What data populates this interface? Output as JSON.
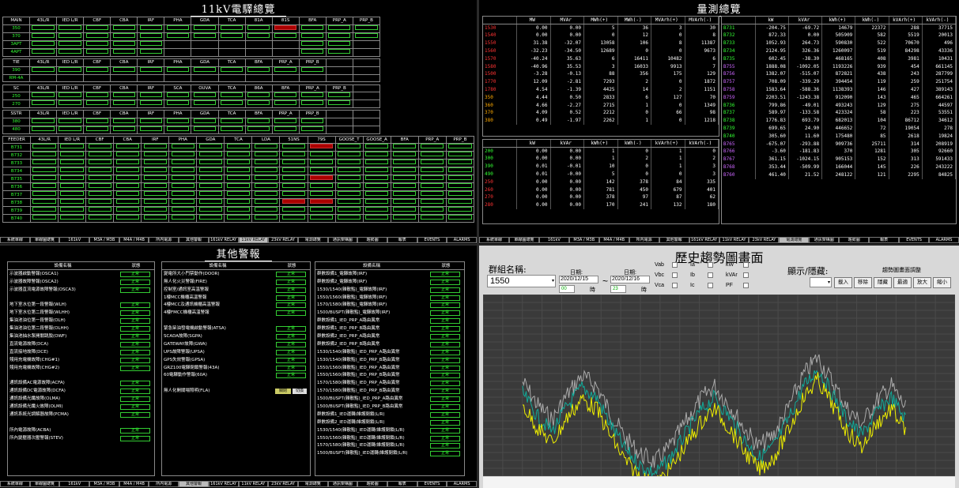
{
  "nav": [
    "系統單線",
    "單線圖總覽",
    "161kV",
    "M3A / M3B",
    "M4A / M4B",
    "所內電源",
    "其他警報",
    "161kV RELAY",
    "11kV RELAY",
    "23kV RELAY",
    "電測總覽",
    "通訊架構圖",
    "趨勢圖",
    "報表",
    "EVENTS",
    "ALARMS"
  ],
  "q1": {
    "title": "11kV電驛總覽",
    "groups": [
      {
        "header": [
          "MAIN",
          "43L/R",
          "IED L/R",
          "CBF",
          "CBA",
          "IRF",
          "PHA",
          "GDA",
          "TCA",
          "81A",
          "81S",
          "BFA",
          "PRP_A",
          "PRP_B"
        ],
        "rows": [
          [
            "350",
            "g",
            "g",
            "g",
            "g",
            "g",
            "g",
            "g",
            "g",
            "g",
            "r",
            "g",
            "g",
            "g"
          ],
          [
            "370",
            "g",
            "g",
            "g",
            "g",
            "g",
            "g",
            "g",
            "g",
            "g",
            "g",
            "g",
            "g",
            "g"
          ],
          [
            "3APT",
            "g",
            "g",
            "g",
            "g",
            "g",
            "",
            "",
            "",
            "",
            "",
            "g",
            "g",
            ""
          ],
          [
            "4APT",
            "g",
            "g",
            "g",
            "g",
            "g",
            "",
            "",
            "",
            "",
            "",
            "g",
            "g",
            ""
          ]
        ]
      },
      {
        "header": [
          "TIE",
          "43L/R",
          "IED L/R",
          "CBF",
          "CBA",
          "IRF",
          "PHA",
          "GDA",
          "TCA",
          "BFA",
          "PRP_A",
          "PRP_B",
          "",
          ""
        ],
        "rows": [
          [
            "390",
            "g",
            "g",
            "g",
            "g",
            "g",
            "g",
            "g",
            "g",
            "g",
            "g",
            "g",
            "",
            ""
          ],
          [
            "RM-4A",
            "",
            "",
            "",
            "",
            "",
            "",
            "",
            "",
            "",
            "",
            "",
            "",
            ""
          ]
        ]
      },
      {
        "header": [
          "SC",
          "43L/R",
          "IED L/R",
          "CBF",
          "CBA",
          "IRF",
          "SCA",
          "OUVA",
          "TCA",
          "86A",
          "BFA",
          "PRP_A",
          "PRP_B",
          ""
        ],
        "rows": [
          [
            "250",
            "g",
            "g",
            "g",
            "g",
            "g",
            "g",
            "g",
            "g",
            "g",
            "g",
            "g",
            "g",
            ""
          ],
          [
            "270",
            "g",
            "g",
            "g",
            "g",
            "g",
            "g",
            "g",
            "g",
            "g",
            "g",
            "g",
            "g",
            ""
          ]
        ]
      },
      {
        "header": [
          "SSTR",
          "43L/R",
          "IED L/R",
          "CBF",
          "CBA",
          "IRF",
          "PHA",
          "GDA",
          "TCA",
          "BFA",
          "PRP_A",
          "PRP_B",
          "",
          ""
        ],
        "rows": [
          [
            "380",
            "g",
            "g",
            "g",
            "g",
            "g",
            "g",
            "g",
            "g",
            "g",
            "g",
            "g",
            "",
            ""
          ],
          [
            "480",
            "g",
            "g",
            "g",
            "g",
            "g",
            "g",
            "g",
            "g",
            "g",
            "g",
            "g",
            "",
            ""
          ]
        ]
      }
    ],
    "feeder_header": [
      "FEEDER",
      "43L/R",
      "IED L/R",
      "CBF",
      "CBA",
      "IRF",
      "PHA",
      "GDA",
      "TCA",
      "LDA",
      "51NS",
      "79S",
      "GOOSE_T",
      "GOOSE_A",
      "BFA",
      "PRP_A",
      "PRP_B"
    ],
    "feeders": [
      "B731",
      "B732",
      "B733",
      "B734",
      "B735",
      "B736",
      "B737",
      "B738",
      "B739",
      "B740"
    ],
    "red_cells": [
      [
        0,
        11
      ],
      [
        4,
        11
      ],
      [
        7,
        10
      ],
      [
        7,
        11
      ]
    ]
  },
  "q2": {
    "title": "量測總覽",
    "t1_header": [
      "",
      "MW",
      "MVAr",
      "MWh(+)",
      "MWh(-)",
      "MVArh(+)",
      "MVArh(-)"
    ],
    "t1_rows": [
      [
        "1530",
        "0.00",
        "0.00",
        "5",
        "36",
        "3",
        "30"
      ],
      [
        "1540",
        "0.00",
        "0.00",
        "0",
        "12",
        "0",
        "8"
      ],
      [
        "1550",
        "31.38",
        "-32.07",
        "13058",
        "106",
        "8",
        "11387"
      ],
      [
        "1560",
        "-32.23",
        "-34.50",
        "12689",
        "0",
        "0",
        "9673"
      ],
      [
        "1570",
        "-40.24",
        "35.63",
        "6",
        "16411",
        "10482",
        "6"
      ],
      [
        "1580",
        "-40.96",
        "35.53",
        "3",
        "16033",
        "9913",
        "7"
      ],
      [
        "1500",
        "-3.28",
        "-0.13",
        "88",
        "356",
        "175",
        "129"
      ],
      [
        "1770",
        "12.09",
        "-2.81",
        "7293",
        "2",
        "0",
        "1872"
      ],
      [
        "1780",
        "4.54",
        "-1.39",
        "4425",
        "14",
        "2",
        "1151"
      ],
      [
        "350",
        "4.44",
        "0.50",
        "2833",
        "6",
        "127",
        "70"
      ],
      [
        "360",
        "4.66",
        "-2.27",
        "2715",
        "1",
        "0",
        "1349"
      ],
      [
        "370",
        "4.09",
        "0.52",
        "2212",
        "0",
        "66",
        "98"
      ],
      [
        "380",
        "0.49",
        "-1.97",
        "2262",
        "1",
        "0",
        "1218"
      ]
    ],
    "t2_header": [
      "",
      "kW",
      "kVAr",
      "kWh(+)",
      "kWh(-)",
      "kVArh(+)",
      "kVArh(-)"
    ],
    "t2_rows": [
      [
        "200",
        "0.00",
        "0.00",
        "1",
        "0",
        "1",
        "0"
      ],
      [
        "300",
        "0.00",
        "0.00",
        "1",
        "2",
        "1",
        "2"
      ],
      [
        "390",
        "0.01",
        "-0.01",
        "10",
        "0",
        "1",
        "3"
      ],
      [
        "490",
        "0.01",
        "-0.00",
        "5",
        "0",
        "0",
        "3"
      ],
      [
        "250",
        "0.00",
        "0.00",
        "142",
        "378",
        "84",
        "335"
      ],
      [
        "260",
        "0.00",
        "0.00",
        "781",
        "450",
        "679",
        "401"
      ],
      [
        "270",
        "0.00",
        "0.00",
        "378",
        "97",
        "87",
        "62"
      ],
      [
        "280",
        "0.00",
        "0.00",
        "170",
        "241",
        "132",
        "180"
      ]
    ],
    "t3_header": [
      "",
      "kW",
      "kVAr",
      "kWh(+)",
      "kWh(-)",
      "kVArh(+)",
      "kVArh(-)"
    ],
    "t3_rows": [
      [
        "B731",
        "-204.75",
        "-69.72",
        "14679",
        "22372",
        "288",
        "37715"
      ],
      [
        "B732",
        "872.33",
        "0.00",
        "505909",
        "582",
        "5519",
        "20013"
      ],
      [
        "B733",
        "1052.93",
        "264.73",
        "590830",
        "522",
        "70670",
        "496"
      ],
      [
        "B734",
        "2124.95",
        "326.36",
        "1260097",
        "519",
        "84298",
        "43336"
      ],
      [
        "B735",
        "602.45",
        "-38.30",
        "468165",
        "408",
        "3981",
        "10431"
      ],
      [
        "B755",
        "1888.08",
        "-1092.05",
        "1193226",
        "939",
        "454",
        "661145"
      ],
      [
        "B756",
        "1382.07",
        "-515.07",
        "872821",
        "438",
        "243",
        "287799"
      ],
      [
        "B757",
        "708.09",
        "-339.29",
        "394454",
        "119",
        "259",
        "251754"
      ],
      [
        "B758",
        "1583.64",
        "-588.36",
        "1138393",
        "146",
        "427",
        "389143"
      ],
      [
        "B759",
        "2203.51",
        "-1243.38",
        "912090",
        "143",
        "465",
        "664261"
      ],
      [
        "B736",
        "799.86",
        "-49.01",
        "493243",
        "129",
        "275",
        "44597"
      ],
      [
        "B737",
        "589.97",
        "-133.58",
        "423324",
        "58",
        "223",
        "53551"
      ],
      [
        "B738",
        "1776.83",
        "693.79",
        "682013",
        "104",
        "86712",
        "34612"
      ],
      [
        "B739",
        "699.65",
        "24.90",
        "446652",
        "72",
        "19054",
        "278"
      ],
      [
        "B740",
        "305.60",
        "11.60",
        "175480",
        "85",
        "2618",
        "19824"
      ],
      [
        "B765",
        "-675.07",
        "-293.88",
        "909736",
        "25711",
        "314",
        "208919"
      ],
      [
        "B766",
        "-3.60",
        "-181.83",
        "370",
        "1281",
        "305",
        "92660"
      ],
      [
        "B767",
        "361.15",
        "-1024.15",
        "905153",
        "152",
        "313",
        "591433"
      ],
      [
        "B768",
        "353.44",
        "-509.99",
        "166044",
        "145",
        "226",
        "243222"
      ],
      [
        "B760",
        "461.40",
        "21.52",
        "248122",
        "121",
        "2295",
        "84825"
      ]
    ]
  },
  "q3": {
    "title": "其他警報",
    "col_header": "設備名稱",
    "status_header": "狀態",
    "col1": [
      {
        "name": "示波器啟動警報(OSCA1)",
        "s": "正常"
      },
      {
        "name": "示波器故障警報(OSCA2)",
        "s": "正常"
      },
      {
        "name": "示波器直流電源故障警報(OSCA3)",
        "s": "正常"
      },
      {
        "name": "",
        "s": ""
      },
      {
        "name": "地下室水位第一段警報(WLH)",
        "s": "正常"
      },
      {
        "name": "地下室水位第二段警報(WLHH)",
        "s": "正常"
      },
      {
        "name": "集油池油位第一段警報(OLH)",
        "s": "正常"
      },
      {
        "name": "集油池油位第二段警報(OLHH)",
        "s": "正常"
      },
      {
        "name": "集油池抽水泵開關跳脫(OWF)",
        "s": "正常"
      },
      {
        "name": "直流電源故障(DCA)",
        "s": "正常"
      },
      {
        "name": "直流接地故障(DCE)",
        "s": "正常"
      },
      {
        "name": "殘用充電機故障(CHG#1)",
        "s": "正常"
      },
      {
        "name": "殘用充電機故障(CHG#2)",
        "s": "正常"
      },
      {
        "name": "",
        "s": ""
      },
      {
        "name": "通訊設備AC電源故障(ACFA)",
        "s": "正常"
      },
      {
        "name": "通訊設備DC電源故障(DCFA)",
        "s": "正常"
      },
      {
        "name": "通訊設備光纖故障(OLMA)",
        "s": "正常"
      },
      {
        "name": "通訊設備光纖火故障(OLMI)",
        "s": "正常"
      },
      {
        "name": "通訊系統光調解器故障(PCMA)",
        "s": "正常"
      },
      {
        "name": "",
        "s": ""
      },
      {
        "name": "所內電源故障(ACBA)",
        "s": "正常"
      },
      {
        "name": "所內變壓器次壓警報(STEV)",
        "s": "正常"
      }
    ],
    "col2": [
      {
        "name": "變電所大小門禁動作(DOOR)",
        "s": "正常"
      },
      {
        "name": "無人化火災警報(FIRE)",
        "s": "正常"
      },
      {
        "name": "控制室/通訊室高溫警報",
        "s": "正常"
      },
      {
        "name": "1樓MCC機櫃高溫警報",
        "s": "正常"
      },
      {
        "name": "4樓MCC及通訊機櫃高溫警報",
        "s": "正常"
      },
      {
        "name": "4樓FMCC機櫃高溫警報",
        "s": "正常"
      },
      {
        "name": "",
        "s": ""
      },
      {
        "name": "緊急柴油發電機啟動警報(ATSA)",
        "s": "正常"
      },
      {
        "name": "SCADA故障(SGPA)",
        "s": "正常"
      },
      {
        "name": "GATEWAY故障(GWA)",
        "s": "正常"
      },
      {
        "name": "UPS故障警報(UPSA)",
        "s": "正常"
      },
      {
        "name": "GPS失效警報(GPSA)",
        "s": "正常"
      },
      {
        "name": "GRZ100電驛閉鎖警報(43A)",
        "s": "正常"
      },
      {
        "name": "60電驛動作警報(60A)",
        "s": "正常"
      },
      {
        "name": "",
        "s": ""
      },
      {
        "name": "無人化開關場照明(FLA)",
        "s": "關閉"
      }
    ],
    "col2_toggle": "切換",
    "col3": [
      "群數設備1_電驛故障(IRF)",
      "群數設備2_電驛故障(IRF)",
      "1530/1540(雜散點)_電驛故障(IRF)",
      "1550/1560(雜散點)_電驛故障(IRF)",
      "1570/1580(雜散點)_電驛故障(IRF)",
      "1500/BUSPT(雜散點)_電驛故障(IRF)",
      "群數設備1_IED_PRP_A路由異常",
      "群數設備1_IED_PRP_B路由異常",
      "群數設備2_IED_PRP_A路由異常",
      "群數設備2_IED_PRP_B路由異常",
      "1530/1540(雜散點)_IED_PRP_A路由異常",
      "1530/1540(雜散點)_IED_PRP_B路由異常",
      "1550/1560(雜散點)_IED_PRP_A路由異常",
      "1550/1560(雜散點)_IED_PRP_B路由異常",
      "1570/1580(雜散點)_IED_PRP_A路由異常",
      "1570/1580(雜散點)_IED_PRP_B路由異常",
      "1500/BUSPT(雜散點)_IED_PRP_A路由異常",
      "1500/BUSPT(雜散點)_IED_PRP_B路由異常",
      "群數設備1_IED運轉/維護閉鎖(L/R)",
      "群數設備2_IED運轉/維護閉鎖(L/R)",
      "1530/1540(雜散點)_IED運轉/維護閉鎖(L/R)",
      "1550/1560(雜散點)_IED運轉/維護閉鎖(L/R)",
      "1570/1580(雜散點)_IED運轉/維護閉鎖(L/R)",
      "1500/BUSPT(雜散點)_IED運轉/維護閉鎖(L/R)"
    ],
    "col3_status": "正常"
  },
  "q4": {
    "title": "歷史趨勢圖畫面",
    "group_label": "群組名稱:",
    "group_value": "1550",
    "date_label1": "日期:",
    "date1": "2020/12/15",
    "hour1": "00",
    "date_label2": "日期:",
    "date2": "2020/12/16",
    "hour2": "23",
    "hour_unit": "時",
    "tilde": "~",
    "checks": [
      "Vab",
      "Vbc",
      "Vca",
      "Ia",
      "Ib",
      "Ic",
      "kW",
      "kVAr",
      "PF"
    ],
    "toggle_label": "顯示/隱藏:",
    "adjust_label": "趨勢圖畫面調整",
    "buttons": [
      "載入",
      "移除",
      "隱藏",
      "最適",
      "放大",
      "縮小"
    ]
  }
}
